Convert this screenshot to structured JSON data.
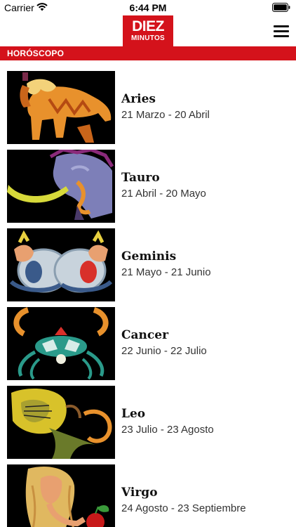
{
  "status_bar": {
    "carrier": "Carrier",
    "time": "6:44 PM",
    "wifi_icon": "wifi-icon",
    "battery_icon": "battery-icon"
  },
  "header": {
    "logo_top": "DIEZ",
    "logo_bottom": "MINUTOS",
    "menu_icon": "hamburger-menu-icon",
    "brand_color": "#d4121b"
  },
  "section": {
    "title": "HORÓSCOPO"
  },
  "signs": [
    {
      "name": "Aries",
      "dates": "21 Marzo - 20 Abril",
      "icon": "aries-ram-illustration"
    },
    {
      "name": "Tauro",
      "dates": "21 Abril - 20 Mayo",
      "icon": "taurus-bull-illustration"
    },
    {
      "name": "Geminis",
      "dates": "21 Mayo - 21 Junio",
      "icon": "gemini-twins-illustration"
    },
    {
      "name": "Cancer",
      "dates": "22 Junio - 22 Julio",
      "icon": "cancer-crab-illustration"
    },
    {
      "name": "Leo",
      "dates": "23 Julio - 23 Agosto",
      "icon": "leo-lion-illustration"
    },
    {
      "name": "Virgo",
      "dates": "24 Agosto - 23 Septiembre",
      "icon": "virgo-maiden-illustration"
    }
  ]
}
